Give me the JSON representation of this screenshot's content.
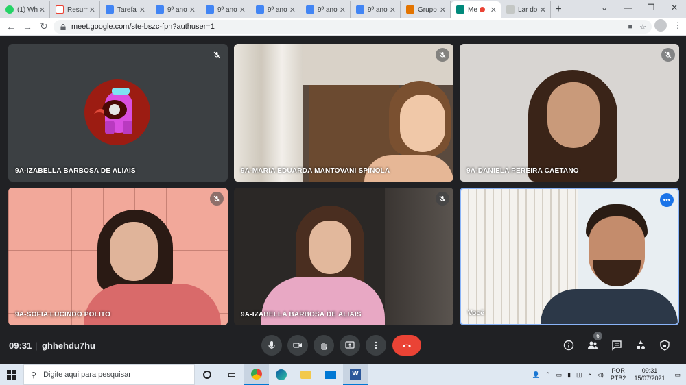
{
  "browser": {
    "tabs": [
      {
        "label": "(1) Wh",
        "color": "#25d366"
      },
      {
        "label": "Resum",
        "color": "#ea4335"
      },
      {
        "label": "Tarefa",
        "color": "#4285f4"
      },
      {
        "label": "9º ano",
        "color": "#4285f4"
      },
      {
        "label": "9º ano",
        "color": "#4285f4"
      },
      {
        "label": "9º ano",
        "color": "#4285f4"
      },
      {
        "label": "9º ano",
        "color": "#4285f4"
      },
      {
        "label": "9º ano",
        "color": "#4285f4"
      },
      {
        "label": "Grupo",
        "color": "#e37400"
      },
      {
        "label": "Me",
        "color": "#00897b"
      },
      {
        "label": "Lar do",
        "color": "#9aa0a6"
      }
    ],
    "url": "meet.google.com/ste-bszc-fph?authuser=1"
  },
  "meet": {
    "participants": [
      {
        "name": "9A-IZABELLA BARBOSA DE ALIAIS"
      },
      {
        "name": "9A-MARIA EDUARDA MANTOVANI SPINOLA"
      },
      {
        "name": "9A-DANIELA PEREIRA CAETANO"
      },
      {
        "name": "9A-SOFIA LUCINDO POLITO"
      },
      {
        "name": "9A-IZABELLA BARBOSA DE ALIAIS"
      },
      {
        "name": "Você"
      }
    ],
    "time": "09:31",
    "meeting_code": "ghhehdu7hu",
    "participant_count": "6"
  },
  "taskbar": {
    "search_placeholder": "Digite aqui para pesquisar",
    "lang_top": "POR",
    "lang_bottom": "PTB2",
    "time": "09:31",
    "date": "15/07/2021"
  },
  "colors": {
    "accent": "#1a73e8",
    "end_call": "#ea4335",
    "self_border": "#8ab4f8"
  }
}
